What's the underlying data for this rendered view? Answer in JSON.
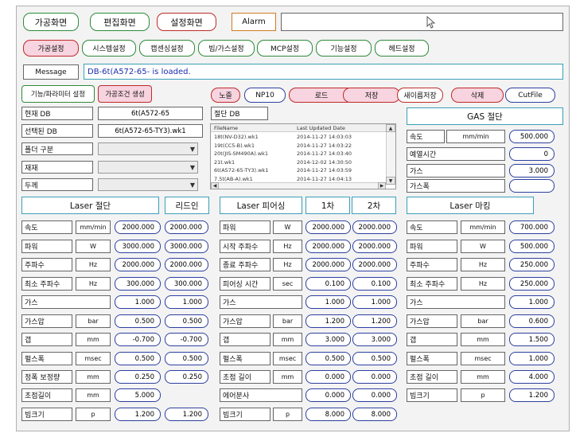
{
  "nav": {
    "process": "가공화면",
    "edit": "편집화면",
    "settings": "설정화면",
    "alarm_label": "Alarm",
    "alarm_value": ""
  },
  "tabs": [
    "가공설정",
    "시스템설정",
    "캡센싱설정",
    "빔/가스설정",
    "MCP설정",
    "기능설정",
    "헤드설정"
  ],
  "message": {
    "label": "Message",
    "text": "DB-6t(A572-65- is loaded."
  },
  "func_buttons": {
    "param_setting": "기능/파라미터 설정",
    "create_cond": "가공조건 생성"
  },
  "db": {
    "current_label": "현재 DB",
    "current_value": "6t(A572-65",
    "selected_label": "선택된 DB",
    "selected_value": "6t(A572-65-TY3).wk1",
    "cutting_db_label": "절단 DB"
  },
  "selects": [
    {
      "label": "폴더 구분",
      "value": ""
    },
    {
      "label": "재재",
      "value": ""
    },
    {
      "label": "두께",
      "value": ""
    }
  ],
  "toolbar": [
    "노즐",
    "NP10",
    "로드",
    "저장",
    "새이름저장",
    "삭제",
    "CutFile"
  ],
  "file_list": {
    "headers": [
      "FileName",
      "Last Updated Date"
    ],
    "rows": [
      [
        "18t(NV-D32).wk1",
        "2014-11-27 14:03:03"
      ],
      [
        "19t(CC5-B).wk1",
        "2014-11-27 14:03:22"
      ],
      [
        "20t(JIS-SM490A).wk1",
        "2014-11-27 14:03:40"
      ],
      [
        "21t.wk1",
        "2014-12-02 14:30:50"
      ],
      [
        "6t(A572-65-TY3).wk1",
        "2014-11-27 14:03:59"
      ],
      [
        "7.5t(AB-A).wk1",
        "2014-11-27 14:04:13"
      ]
    ]
  },
  "gas_cut": {
    "title": "GAS 절단",
    "rows": [
      {
        "label": "속도",
        "unit": "mm/min",
        "value": "500.000"
      },
      {
        "label": "예열시간",
        "unit": "",
        "value": "0"
      },
      {
        "label": "가스",
        "unit": "",
        "value": "3.000"
      },
      {
        "label": "가스폭",
        "unit": "",
        "value": ""
      }
    ]
  },
  "laser_cut": {
    "title": "Laser 절단",
    "leadin_title": "리드인",
    "rows": [
      {
        "label": "속도",
        "unit": "mm/min",
        "value": "2000.000",
        "leadin": "2000.000"
      },
      {
        "label": "파워",
        "unit": "W",
        "value": "3000.000",
        "leadin": "3000.000"
      },
      {
        "label": "주파수",
        "unit": "Hz",
        "value": "2000.000",
        "leadin": "2000.000"
      },
      {
        "label": "최소 주파수",
        "unit": "Hz",
        "value": "300.000",
        "leadin": "300.000"
      },
      {
        "label": "가스",
        "unit": "",
        "value": "1.000",
        "leadin": "1.000"
      },
      {
        "label": "가스압",
        "unit": "bar",
        "value": "0.500",
        "leadin": "0.500"
      },
      {
        "label": "갭",
        "unit": "mm",
        "value": "-0.700",
        "leadin": "-0.700"
      },
      {
        "label": "펄스폭",
        "unit": "msec",
        "value": "0.500",
        "leadin": "0.500"
      },
      {
        "label": "정폭 보정량",
        "unit": "mm",
        "value": "0.250",
        "leadin": "0.250"
      },
      {
        "label": "초점길이",
        "unit": "mm",
        "value": "5.000",
        "leadin": ""
      },
      {
        "label": "빔크기",
        "unit": "p",
        "value": "1.200",
        "leadin": "1.200"
      }
    ]
  },
  "laser_pierce": {
    "title": "Laser 피어싱",
    "col1": "1차",
    "col2": "2차",
    "rows": [
      {
        "label": "파워",
        "unit": "W",
        "v1": "2000.000",
        "v2": "2000.000"
      },
      {
        "label": "시작 주파수",
        "unit": "Hz",
        "v1": "2000.000",
        "v2": "2000.000"
      },
      {
        "label": "종료 주파수",
        "unit": "Hz",
        "v1": "2000.000",
        "v2": "2000.000"
      },
      {
        "label": "피어싱 시간",
        "unit": "sec",
        "v1": "0.100",
        "v2": "0.100"
      },
      {
        "label": "가스",
        "unit": "",
        "v1": "1.000",
        "v2": "1.000"
      },
      {
        "label": "가스압",
        "unit": "bar",
        "v1": "1.200",
        "v2": "1.200"
      },
      {
        "label": "갭",
        "unit": "mm",
        "v1": "3.000",
        "v2": "3.000"
      },
      {
        "label": "펄스폭",
        "unit": "msec",
        "v1": "0.500",
        "v2": "0.500"
      },
      {
        "label": "초점 길이",
        "unit": "mm",
        "v1": "0.000",
        "v2": "0.000"
      },
      {
        "label": "에어분사",
        "unit": "",
        "v1": "0.000",
        "v2": "0.000"
      },
      {
        "label": "빔크기",
        "unit": "p",
        "v1": "8.000",
        "v2": "8.000"
      }
    ]
  },
  "laser_mark": {
    "title": "Laser 마킹",
    "rows": [
      {
        "label": "속도",
        "unit": "mm/min",
        "value": "700.000"
      },
      {
        "label": "파워",
        "unit": "W",
        "value": "500.000"
      },
      {
        "label": "주파수",
        "unit": "Hz",
        "value": "250.000"
      },
      {
        "label": "최소 주파수",
        "unit": "Hz",
        "value": "250.000"
      },
      {
        "label": "가스",
        "unit": "",
        "value": "1.000"
      },
      {
        "label": "가스압",
        "unit": "bar",
        "value": "0.600"
      },
      {
        "label": "갭",
        "unit": "mm",
        "value": "1.500"
      },
      {
        "label": "펄스폭",
        "unit": "msec",
        "value": "1.000"
      },
      {
        "label": "초점 길이",
        "unit": "mm",
        "value": "4.000"
      },
      {
        "label": "빔크기",
        "unit": "p",
        "value": "1.200"
      }
    ]
  }
}
